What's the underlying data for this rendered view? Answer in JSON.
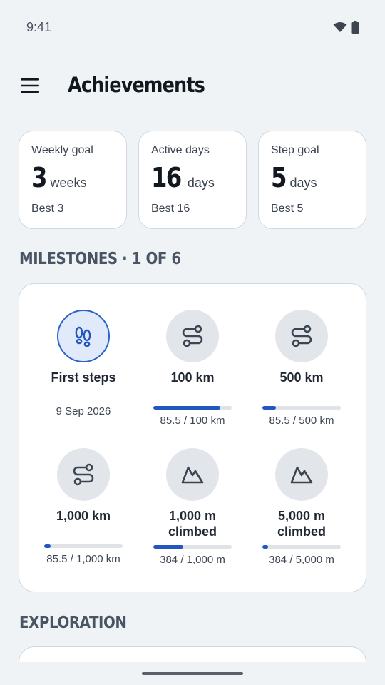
{
  "status": {
    "time": "9:41"
  },
  "header": {
    "title": "Achievements"
  },
  "stats": [
    {
      "label": "Weekly goal",
      "value": "3",
      "unit": "weeks",
      "best": "Best 3"
    },
    {
      "label": "Active days",
      "value": "16",
      "unit": "days",
      "best": "Best 16"
    },
    {
      "label": "Step goal",
      "value": "5",
      "unit": "days",
      "best": "Best 5"
    }
  ],
  "milestones": {
    "heading": "MILESTONES · 1 OF 6",
    "items": [
      {
        "title": "First steps",
        "icon": "footprints-icon",
        "achieved": true,
        "date": "9 Sep 2026"
      },
      {
        "title": "100 km",
        "icon": "route-icon",
        "achieved": false,
        "progress_text": "85.5 / 100 km",
        "progress": 0.855
      },
      {
        "title": "500 km",
        "icon": "route-icon",
        "achieved": false,
        "progress_text": "85.5 / 500 km",
        "progress": 0.171
      },
      {
        "title": "1,000 km",
        "icon": "route-icon",
        "achieved": false,
        "progress_text": "85.5 / 1,000 km",
        "progress": 0.0855
      },
      {
        "title": "1,000 m climbed",
        "icon": "mountain-icon",
        "achieved": false,
        "progress_text": "384 / 1,000 m",
        "progress": 0.384
      },
      {
        "title": "5,000 m climbed",
        "icon": "mountain-icon",
        "achieved": false,
        "progress_text": "384 / 5,000 m",
        "progress": 0.0768
      }
    ]
  },
  "exploration": {
    "heading": "EXPLORATION"
  },
  "colors": {
    "accent": "#2357c0",
    "background": "#eff3f6",
    "card": "#ffffff"
  }
}
